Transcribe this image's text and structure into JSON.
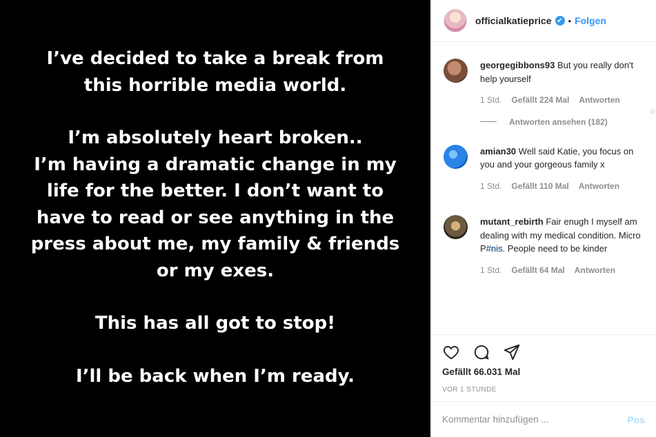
{
  "media": {
    "paragraphs": [
      [
        "I’ve decided to take a break from",
        "this horrible media world."
      ],
      [
        "I’m absolutely heart broken..",
        "I’m having a dramatic change in my",
        "life for the better. I don’t want to",
        "have to read or see anything in the",
        "press about me, my family & friends",
        "or my exes."
      ],
      [
        "This has all got to stop!"
      ],
      [
        "I’ll be back when I’m ready."
      ]
    ]
  },
  "header": {
    "username": "officialkatieprice",
    "verified_mark": "✔",
    "separator": "•",
    "follow_label": "Folgen"
  },
  "comments": [
    {
      "user": "georgegibbons93",
      "text": "But you really don't help yourself",
      "time": "1 Std.",
      "likes": "Gefällt 224 Mal",
      "reply": "Antworten",
      "view_replies": "Antworten ansehen (182)"
    },
    {
      "user": "amian30",
      "text": "Well said Katie, you focus on you and your gorgeous family x",
      "time": "1 Std.",
      "likes": "Gefällt 110 Mal",
      "reply": "Antworten"
    },
    {
      "user": "mutant_rebirth",
      "text_before": "Fair enugh I myself am dealing with my medical condition. Micro P",
      "hashtag": "#nis",
      "text_after": ". People need to be kinder",
      "time": "1 Std.",
      "likes": "Gefällt 64 Mal",
      "reply": "Antworten"
    }
  ],
  "actions": {
    "icons": [
      "heart-icon",
      "comment-icon",
      "share-icon"
    ],
    "likes": "Gefällt 66.031 Mal",
    "time": "VOR 1 STUNDE"
  },
  "comment_box": {
    "placeholder": "Kommentar hinzufügen ...",
    "post_label": "Pos"
  },
  "colors": {
    "accent": "#3897f0",
    "text": "#262626",
    "muted": "#8e8e8e",
    "border": "#efefef"
  }
}
